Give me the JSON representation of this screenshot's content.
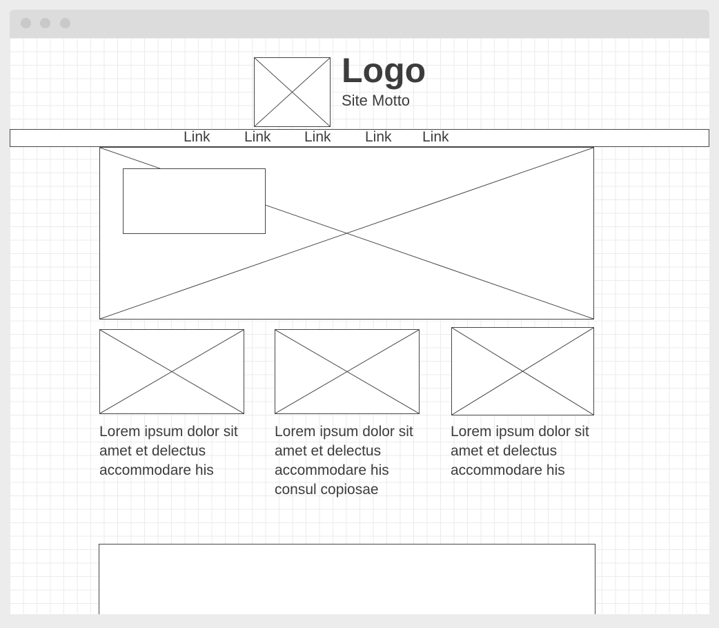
{
  "header": {
    "logo_text": "Logo",
    "motto": "Site Motto",
    "logo_image_icon": "image-placeholder-icon"
  },
  "nav": {
    "links": [
      "Link",
      "Link",
      "Link",
      "Link",
      "Link"
    ]
  },
  "hero": {
    "image_icon": "image-placeholder-icon"
  },
  "cards": [
    {
      "text": "Lorem ipsum dolor sit amet et delectus accommodare his"
    },
    {
      "text": "Lorem ipsum dolor sit amet et delectus accommodare his consul copiosae"
    },
    {
      "text": "Lorem ipsum dolor sit amet et delectus accommodare his"
    }
  ],
  "colors": {
    "stroke": "#444444",
    "text": "#3c3c3c",
    "titlebar": "#dcdcdc",
    "grid": "#ebebeb"
  }
}
